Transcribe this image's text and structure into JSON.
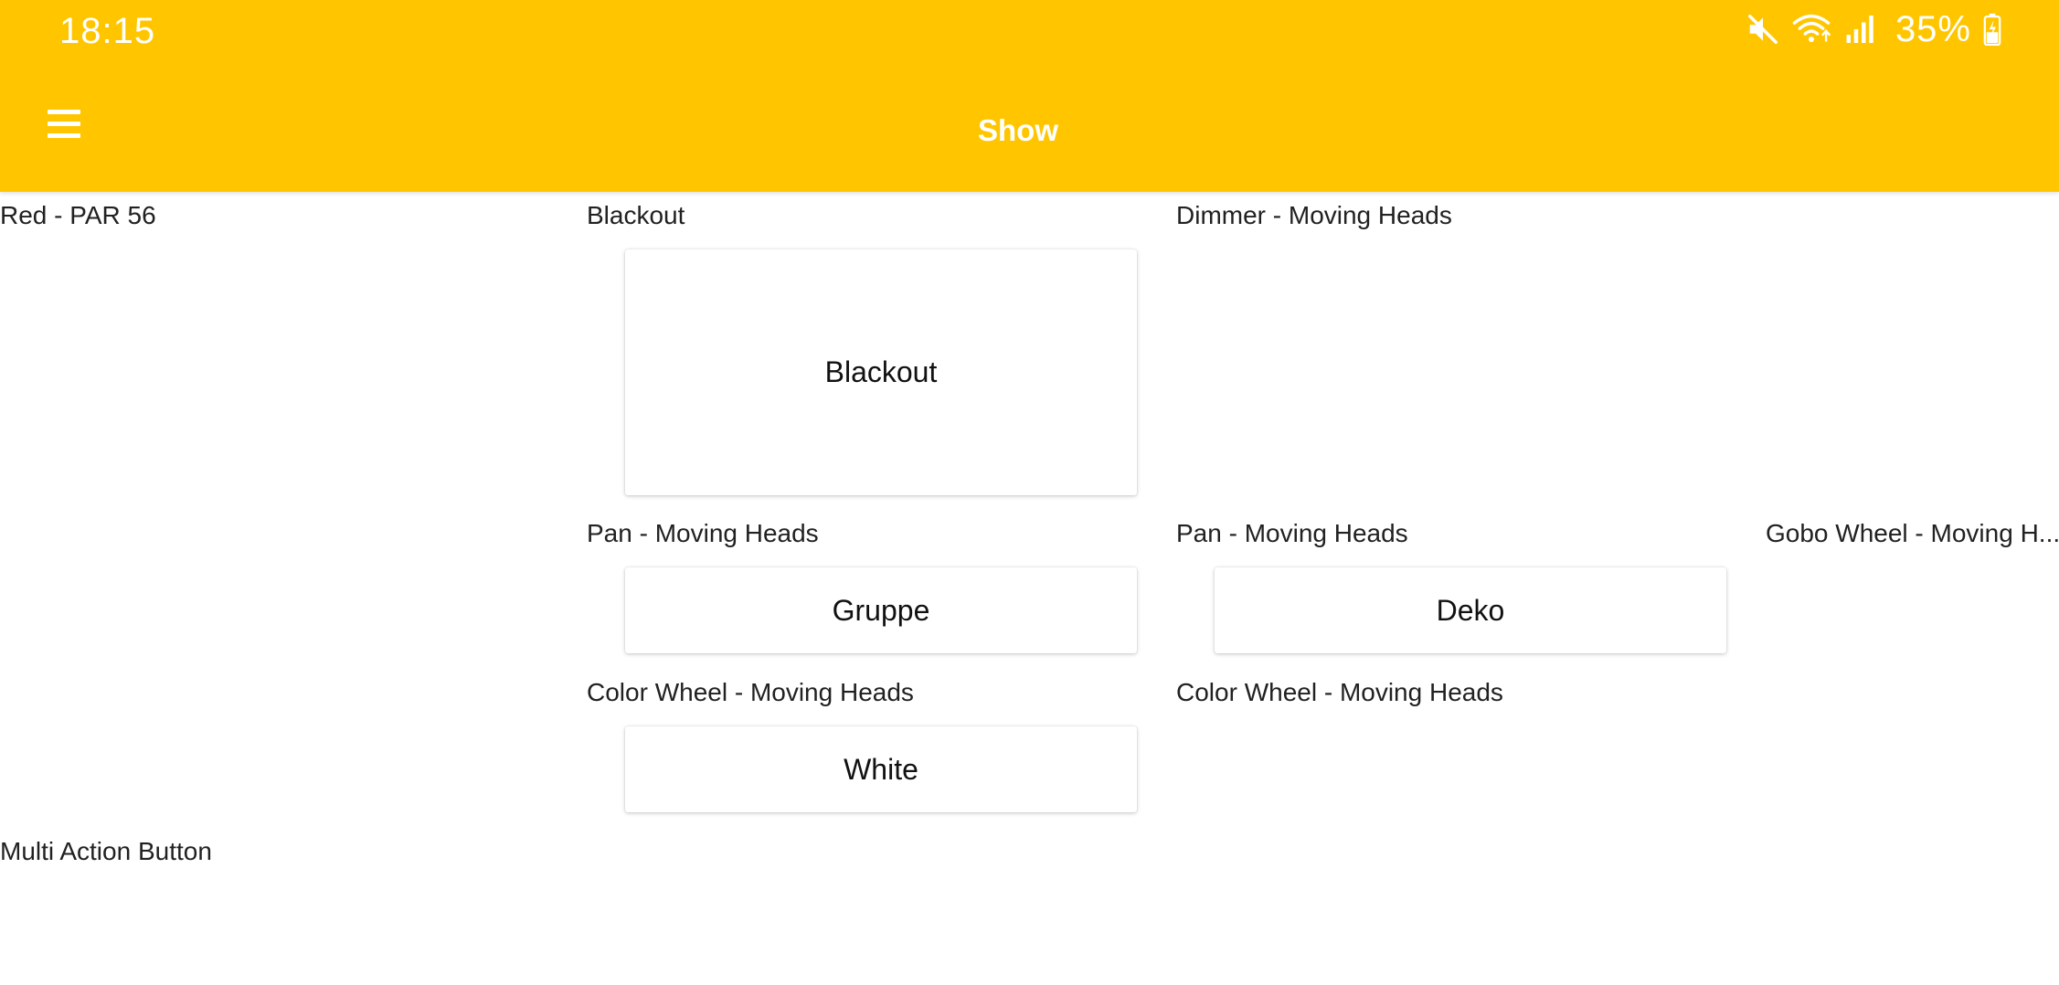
{
  "status_bar": {
    "time": "18:15",
    "battery": "35%",
    "icons": [
      "mute-icon",
      "wifi-icon",
      "signal-icon",
      "battery-charging-icon"
    ]
  },
  "app_bar": {
    "title": "Show",
    "menu_icon": "hamburger-menu-icon",
    "color": "#FFC600"
  },
  "cells": {
    "red_par56": {
      "label": "Red - PAR 56"
    },
    "blackout": {
      "label": "Blackout",
      "button": "Blackout"
    },
    "dimmer": {
      "label": "Dimmer - Moving Heads"
    },
    "pan_group": {
      "label": "Pan - Moving Heads",
      "button": "Gruppe"
    },
    "pan_deko": {
      "label": "Pan - Moving Heads",
      "button": "Deko"
    },
    "gobo": {
      "label": "Gobo Wheel - Moving H..."
    },
    "color_white": {
      "label": "Color Wheel - Moving Heads",
      "button": "White"
    },
    "color_2": {
      "label": "Color Wheel - Moving Heads"
    },
    "multi_action": {
      "label": "Multi Action Button"
    }
  }
}
